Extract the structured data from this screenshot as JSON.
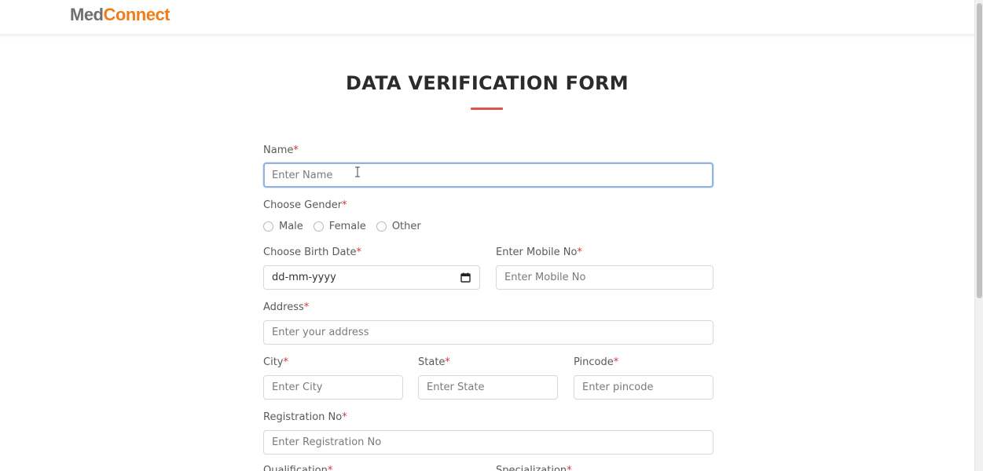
{
  "brand": {
    "part1": "Med",
    "part2": "Connect"
  },
  "form": {
    "title": "DATA VERIFICATION FORM",
    "required_mark": "*",
    "name": {
      "label": "Name",
      "placeholder": "Enter Name"
    },
    "gender": {
      "label": "Choose Gender",
      "options": [
        "Male",
        "Female",
        "Other"
      ]
    },
    "birth_date": {
      "label": "Choose Birth Date",
      "value": "dd-mm-yyyy"
    },
    "mobile": {
      "label": "Enter Mobile No",
      "placeholder": "Enter Mobile No"
    },
    "address": {
      "label": "Address",
      "placeholder": "Enter your address"
    },
    "city": {
      "label": "City",
      "placeholder": "Enter City"
    },
    "state": {
      "label": "State",
      "placeholder": "Enter State"
    },
    "pincode": {
      "label": "Pincode",
      "placeholder": "Enter pincode"
    },
    "registration": {
      "label": "Registration No",
      "placeholder": "Enter Registration No"
    },
    "qualification": {
      "label": "Qualification"
    },
    "specialization": {
      "label": "Specialization"
    }
  },
  "icons": {
    "calendar": "calendar-icon",
    "cursor": "text-cursor-icon"
  },
  "colors": {
    "accent": "#e0504f",
    "brand_orange": "#f07d1a",
    "brand_gray": "#6f6f6f",
    "required": "#d9333f",
    "focus": "#93b3de"
  }
}
